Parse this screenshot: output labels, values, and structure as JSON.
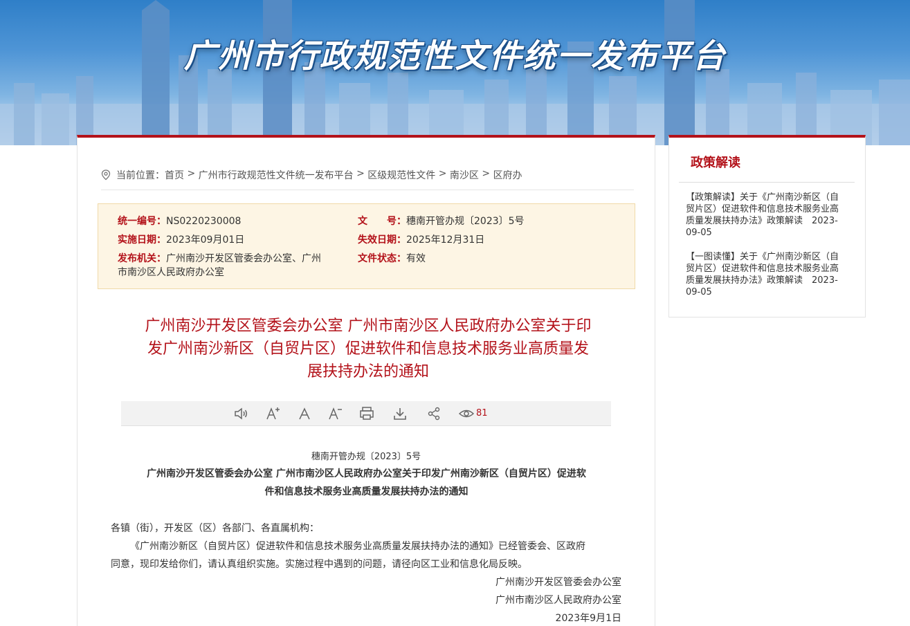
{
  "banner": {
    "title": "广州市行政规范性文件统一发布平台"
  },
  "breadcrumb": {
    "label": "当前位置：",
    "items": [
      "首页",
      "广州市行政规范性文件统一发布平台",
      "区级规范性文件",
      "南沙区",
      "区府办"
    ],
    "separator": ">"
  },
  "meta": {
    "code_label": "统一编号：",
    "code_value": "NS0220230008",
    "docno_label": "文　　号：",
    "docno_value": "穗南开管办规〔2023〕5号",
    "effective_label": "实施日期：",
    "effective_value": "2023年09月01日",
    "expire_label": "失效日期：",
    "expire_value": "2025年12月31日",
    "issuer_label": "发布机关：",
    "issuer_value_line1": "广州南沙开发区管委会办公室、广州",
    "issuer_value_line2": "市南沙区人民政府办公室",
    "status_label": "文件状态：",
    "status_value": "有效"
  },
  "document": {
    "title_line1": "广州南沙开发区管委会办公室 广州市南沙区人民政府办公室关于印",
    "title_line2": "发广州南沙新区（自贸片区）促进软件和信息技术服务业高质量发",
    "title_line3": "展扶持办法的通知",
    "view_count": "81",
    "doc_number": "穗南开管办规〔2023〕5号",
    "heading_line1": "广州南沙开发区管委会办公室  广州市南沙区人民政府办公室关于印发广州南沙新区（自贸片区）促进软",
    "heading_line2": "件和信息技术服务业高质量发展扶持办法的通知",
    "salutation": "各镇（街），开发区（区）各部门、各直属机构：",
    "paragraph_line1": "《广州南沙新区（自贸片区）促进软件和信息技术服务业高质量发展扶持办法的通知》已经管委会、区政府",
    "paragraph_line2": "同意，现印发给你们，请认真组织实施。实施过程中遇到的问题，请径向区工业和信息化局反映。",
    "signer1": "广州南沙开发区管委会办公室",
    "signer2": "广州市南沙区人民政府办公室",
    "date": "2023年9月1日"
  },
  "toolbar": {
    "icons": [
      "speaker-icon",
      "font-increase-icon",
      "font-reset-icon",
      "font-decrease-icon",
      "print-icon",
      "download-icon",
      "share-icon",
      "eye-icon"
    ]
  },
  "sidebar": {
    "title": "政策解读",
    "items": [
      {
        "line1": "【政策解读】关于《广州南沙新区（自",
        "line2": "贸片区）促进软件和信息技术服务业高",
        "line3": "质量发展扶持办法》政策解读　2023-",
        "line4": "09-05"
      },
      {
        "line1": "【一图读懂】关于《广州南沙新区（自",
        "line2": "贸片区）促进软件和信息技术服务业高",
        "line3": "质量发展扶持办法》政策解读　2023-",
        "line4": "09-05"
      }
    ]
  },
  "colors": {
    "accent_red": "#b3121a",
    "meta_bg": "#fdf5e4",
    "banner_blue": "#2f7fc8"
  }
}
